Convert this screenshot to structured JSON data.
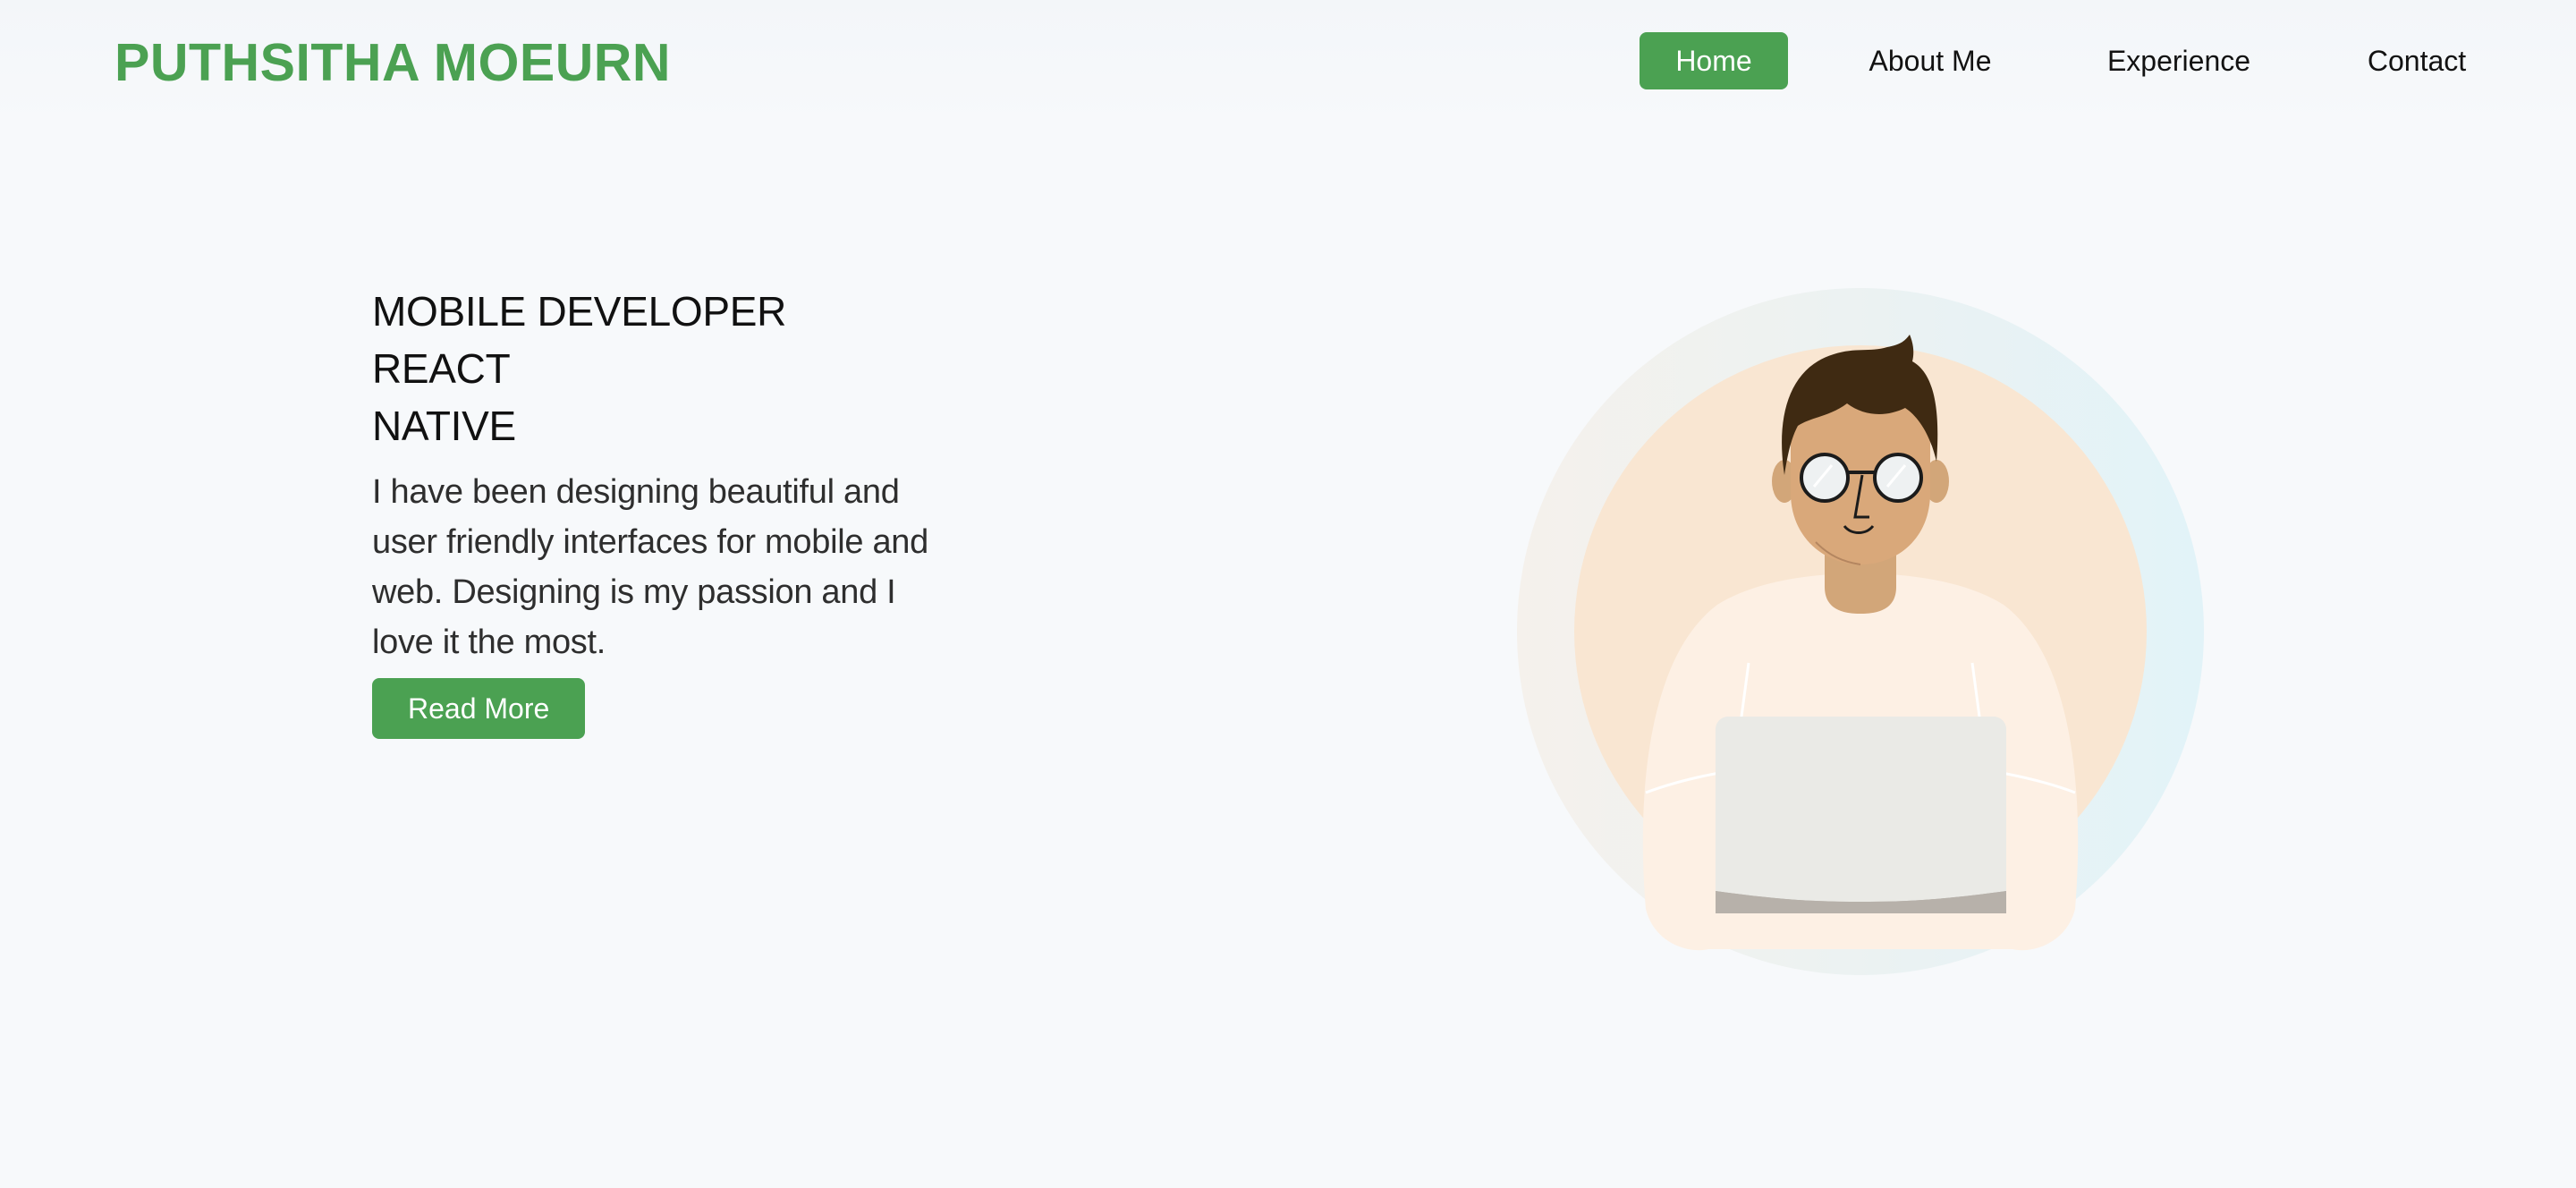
{
  "header": {
    "logo_text": "PUTHSITHA MOEURN",
    "nav": [
      {
        "label": "Home",
        "active": true
      },
      {
        "label": "About Me",
        "active": false
      },
      {
        "label": "Experience",
        "active": false
      },
      {
        "label": "Contact",
        "active": false
      }
    ]
  },
  "hero": {
    "title_lines": [
      "MOBILE DEVELOPER",
      "REACT",
      "NATIVE"
    ],
    "description_lines": [
      "I have been designing beautiful and",
      "user friendly interfaces for mobile and",
      "web. Designing is my passion and I",
      "love it the most."
    ],
    "cta_label": "Read More",
    "illustration": "developer-with-laptop-illustration"
  },
  "colors": {
    "accent": "#4ba152",
    "background": "#f7f9fb",
    "text": "#111111"
  }
}
